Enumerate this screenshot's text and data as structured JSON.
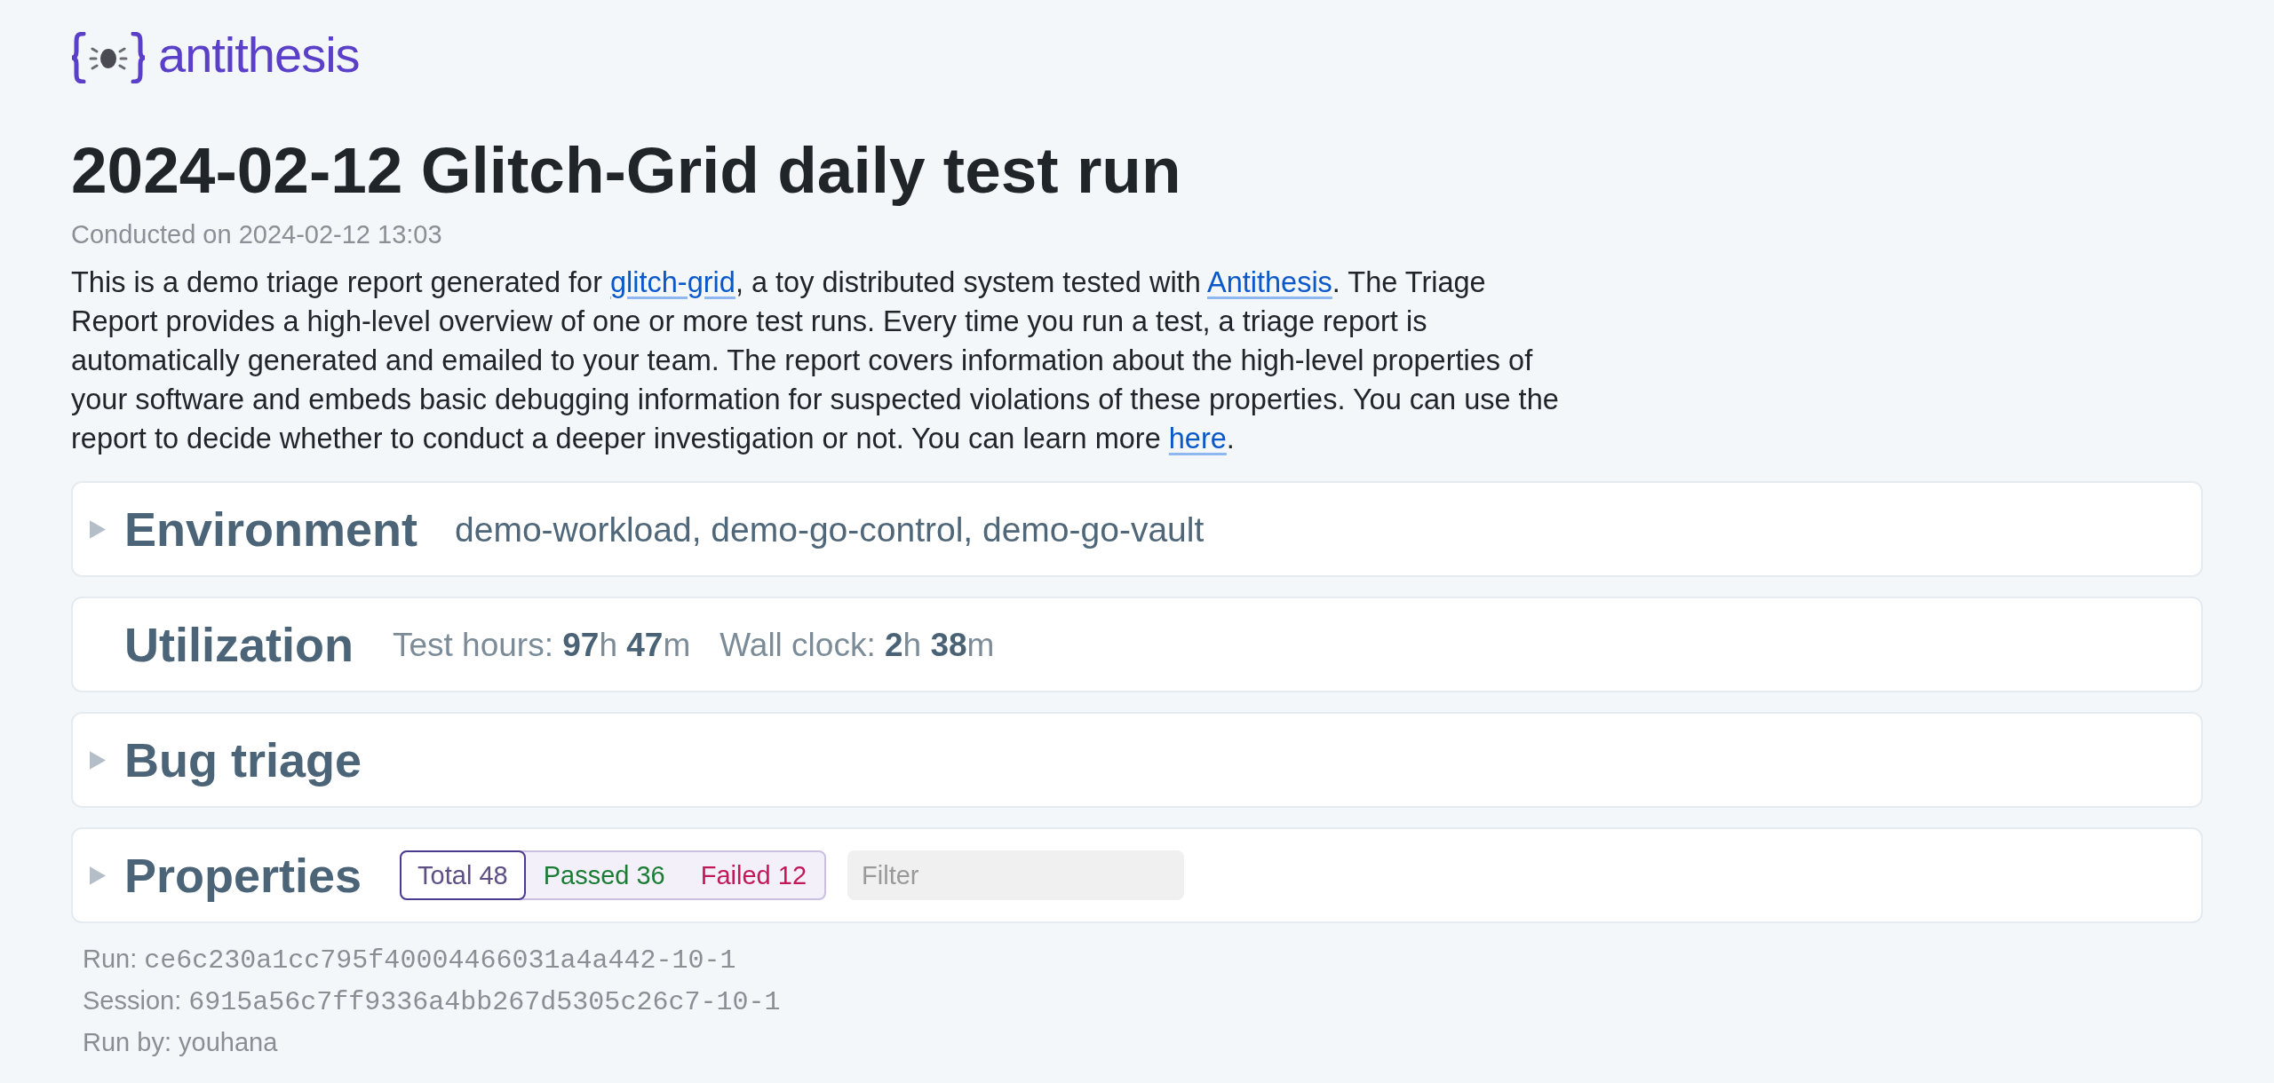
{
  "logo": {
    "wordmark": "antithesis"
  },
  "title": "2024-02-12 Glitch-Grid daily test run",
  "conducted": "Conducted on 2024-02-12 13:03",
  "intro": [
    {
      "kind": "text",
      "text": "This is a demo triage report generated for "
    },
    {
      "kind": "link",
      "text": "glitch-grid"
    },
    {
      "kind": "text",
      "text": ", a toy distributed system tested with "
    },
    {
      "kind": "link",
      "text": "Antithesis"
    },
    {
      "kind": "text",
      "text": ". The Triage Report provides a high-level overview of one or more test runs. Every time you run a test, a triage report is automatically generated and emailed to your team. The report covers information about the high-level properties of your software and embeds basic debugging information for suspected violations of these properties. You can use the report to decide whether to conduct a deeper investigation or not. You can learn more "
    },
    {
      "kind": "link",
      "text": "here"
    },
    {
      "kind": "text",
      "text": "."
    }
  ],
  "sections": [
    {
      "kind": "summary",
      "title": "Environment",
      "expanded": false,
      "summary": "demo-workload, demo-go-control, demo-go-vault"
    },
    {
      "kind": "stats",
      "title": "Utilization",
      "stats": [
        "Test hours: **97**h **47**m",
        "Wall clock: **2**h **38**m"
      ]
    },
    {
      "kind": "summary",
      "title": "Bug triage",
      "expanded": false
    },
    {
      "kind": "properties",
      "title": "Properties",
      "expanded": false,
      "tabs": [
        {
          "label": "Total 48",
          "selected": true,
          "color": "#5e4f86"
        },
        {
          "label": "Passed 36",
          "selected": false,
          "color": "#1b7d35"
        },
        {
          "label": "Failed 12",
          "selected": false,
          "color": "#c2185b"
        }
      ],
      "filter": {
        "placeholder": "Filter"
      }
    }
  ],
  "run_info": [
    {
      "kind": "mono",
      "label": "Run:",
      "value": "ce6c230a1cc795f40004466031a4a442-10-1"
    },
    {
      "kind": "mono",
      "label": "Session:",
      "value": "6915a56c7ff9336a4bb267d5305c26c7-10-1"
    },
    {
      "kind": "plain",
      "label": "Run by:",
      "value": "youhana"
    }
  ]
}
